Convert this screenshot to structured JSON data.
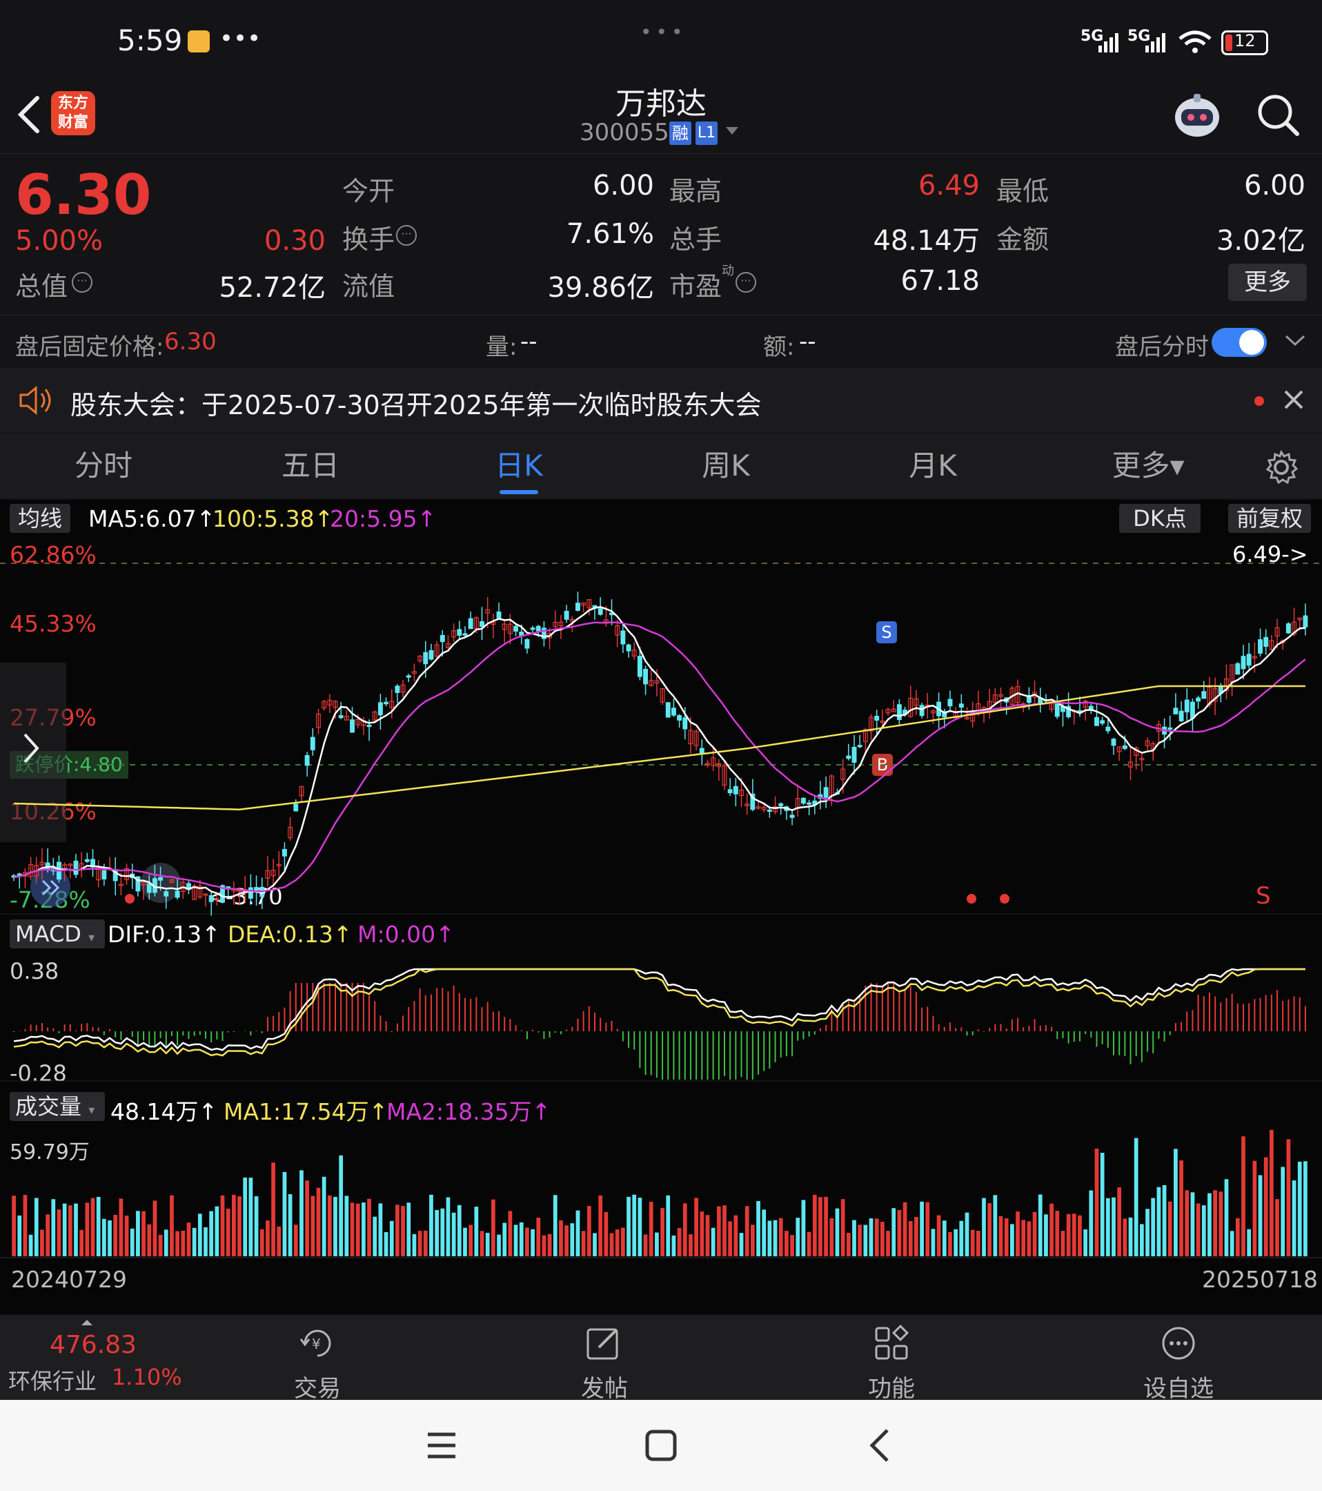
{
  "status_bar": {
    "time": "5:59",
    "battery": "12",
    "signal_1": "5G",
    "signal_2": "5G"
  },
  "header": {
    "title": "万邦达",
    "code": "300055",
    "badge_rong": "融",
    "badge_l1": "L1",
    "logo_text": "东方财富"
  },
  "quote": {
    "price": "6.30",
    "change_pct": "5.00%",
    "change_abs": "0.30",
    "open_label": "今开",
    "open": "6.00",
    "high_label": "最高",
    "high": "6.49",
    "low_label": "最低",
    "low": "6.00",
    "turnover_label": "换手",
    "turnover": "7.61%",
    "volume_label": "总手",
    "volume": "48.14万",
    "amount_label": "金额",
    "amount": "3.02亿",
    "mktcap_label": "总值",
    "mktcap": "52.72亿",
    "float_label": "流值",
    "float_cap": "39.86亿",
    "pe_label": "市盈",
    "pe_sup": "动",
    "pe": "67.18",
    "more_button": "更多"
  },
  "after_hours": {
    "fixed_price_label": "盘后固定价格:",
    "fixed_price": "6.30",
    "vol_label": "量:",
    "vol": "--",
    "amt_label": "额:",
    "amt": "--",
    "toggle_label": "盘后分时"
  },
  "notice": {
    "text": "股东大会：于2025-07-30召开2025年第一次临时股东大会"
  },
  "tabs": [
    {
      "label": "分时"
    },
    {
      "label": "五日"
    },
    {
      "label": "日K"
    },
    {
      "label": "周K"
    },
    {
      "label": "月K"
    },
    {
      "label": "更多▾"
    }
  ],
  "ma_bar": {
    "label": "均线",
    "ma5": "MA5:6.07↑",
    "ma100": "100:5.38↑",
    "ma20": "20:5.95↑",
    "dk_button": "DK点",
    "adjust_button": "前复权"
  },
  "kline": {
    "pct_labels": [
      "62.86%",
      "45.33%",
      "27.79%",
      "10.26%",
      "-7.28%"
    ],
    "limit_down_label": "跌停价:4.80",
    "high_marker": "6.49->",
    "low_marker": "<-3.70",
    "sell_marker": "S",
    "buy_marker": "B",
    "s_bottom": "S"
  },
  "macd": {
    "label": "MACD",
    "dif": "DIF:0.13↑",
    "dea": "DEA:0.13↑",
    "m": "M:0.00↑",
    "top": "0.38",
    "bottom": "-0.28"
  },
  "volume": {
    "label": "成交量",
    "vol": "48.14万↑",
    "ma1": "MA1:17.54万↑",
    "ma2": "MA2:18.35万↑",
    "top": "59.79万"
  },
  "dates": {
    "start": "20240729",
    "end": "20250718"
  },
  "bottom_bar": {
    "index_value": "476.83",
    "index_name": "环保行业",
    "index_pct": "1.10%",
    "trade": "交易",
    "post": "发帖",
    "func": "功能",
    "watch": "设自选"
  },
  "colors": {
    "up": "#e53935",
    "down": "#5ee7f0",
    "ma5": "#ffffff",
    "ma20": "#d63ad6",
    "ma100": "#f3e35a",
    "accent": "#3a82f7"
  }
}
